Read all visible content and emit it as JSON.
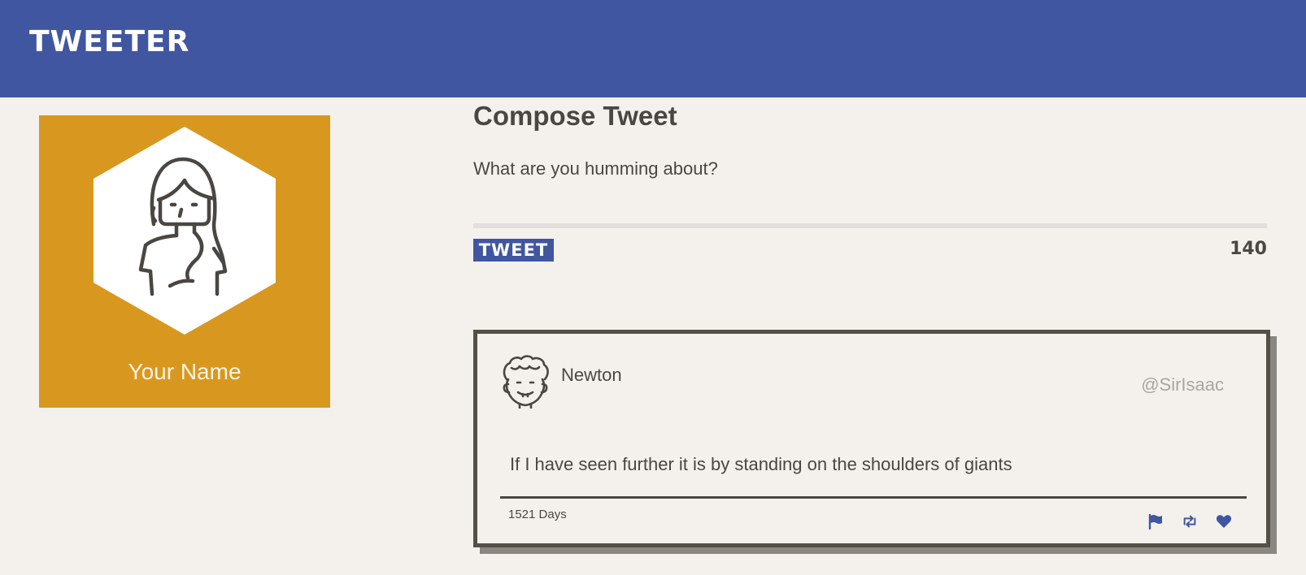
{
  "header": {
    "brand": "TWEETER"
  },
  "profile": {
    "name": "Your Name",
    "card_color": "#d8981f"
  },
  "compose": {
    "title": "Compose Tweet",
    "placeholder": "What are you humming about?",
    "button_label": "TWEET",
    "char_count": "140"
  },
  "tweet": {
    "author": "Newton",
    "handle": "@SirIsaac",
    "text": "If I have seen further it is by standing on the shoulders of giants",
    "age": "1521 Days",
    "actions": [
      "flag-icon",
      "retweet-icon",
      "heart-icon"
    ]
  },
  "colors": {
    "brand_blue": "#4056a1",
    "background": "#f4f1ec",
    "text": "#4a4742",
    "handle": "#a8a6a2"
  }
}
